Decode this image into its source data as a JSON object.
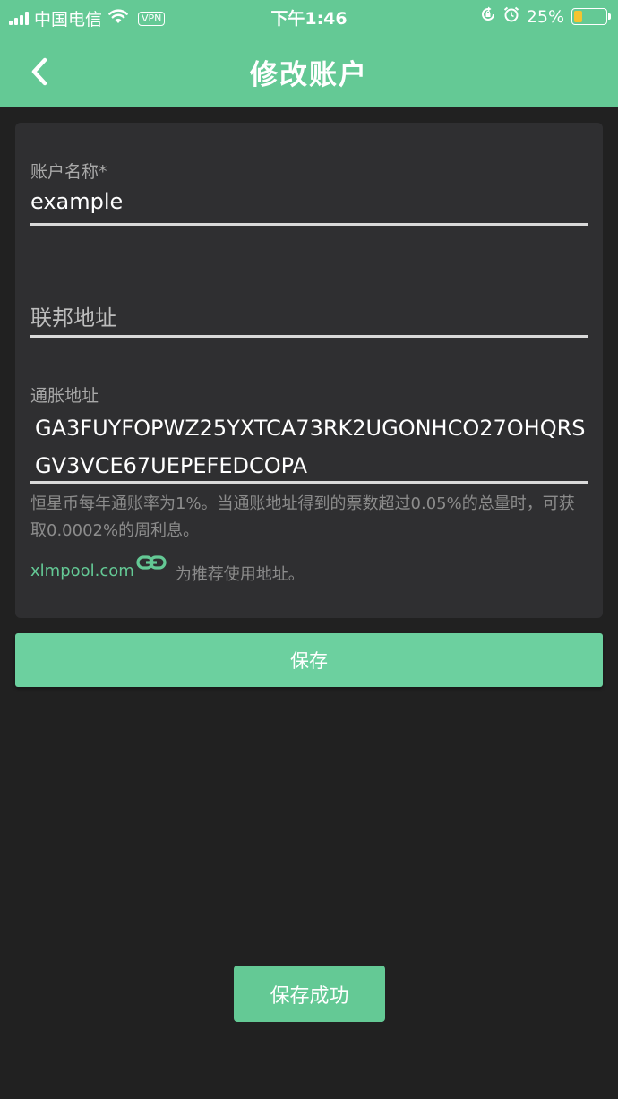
{
  "status_bar": {
    "carrier": "中国电信",
    "vpn": "VPN",
    "time": "下午1:46",
    "battery_percent": "25%",
    "battery_level": 0.25,
    "icons": [
      "signal-icon",
      "wifi-icon",
      "orientation-lock-icon",
      "alarm-icon",
      "battery-icon"
    ]
  },
  "header": {
    "title": "修改账户",
    "back_icon": "chevron-left-icon"
  },
  "form": {
    "account_name": {
      "label": "账户名称*",
      "value": "example"
    },
    "federation_address": {
      "placeholder": "联邦地址"
    },
    "inflation_address": {
      "label": "通胀地址",
      "value": "GA3FUYFOPWZ25YXTCA73RK2UGONHCO27OHQRSGV3VCE67UEPEFEDCOPA"
    },
    "hint": "恒星币每年通账率为1%。当通账地址得到的票数超过0.05%的总量时，可获取0.0002%的周利息。",
    "recommend": {
      "link": "xlmpool.com",
      "link_icon": "link-icon",
      "suffix": "为推荐使用地址。"
    }
  },
  "save_button": "保存",
  "toast": "保存成功",
  "colors": {
    "accent": "#64c995",
    "background": "#212121",
    "card": "#2f2f31"
  }
}
